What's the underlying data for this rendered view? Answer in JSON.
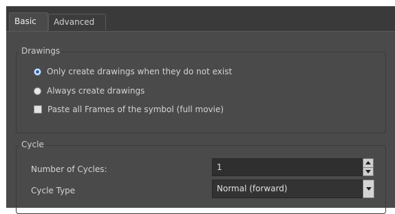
{
  "tabs": [
    {
      "label": "Basic",
      "active": true
    },
    {
      "label": "Advanced",
      "active": false
    }
  ],
  "drawings": {
    "title": "Drawings",
    "option_only_create": "Only create drawings when they do not exist",
    "option_always_create": "Always create drawings",
    "selected_option": "Only create drawings when they do not exist",
    "paste_all_frames_label": "Paste all Frames of the symbol (full movie)",
    "paste_all_frames_checked": false
  },
  "cycle": {
    "title": "Cycle",
    "number_of_cycles_label": "Number of Cycles:",
    "number_of_cycles_value": "1",
    "cycle_type_label": "Cycle Type",
    "cycle_type_value": "Normal (forward)"
  },
  "colors": {
    "panel_bg": "#4a4a4a",
    "input_bg": "#2f2f2f",
    "radio_selected": "#2e5ea8"
  }
}
